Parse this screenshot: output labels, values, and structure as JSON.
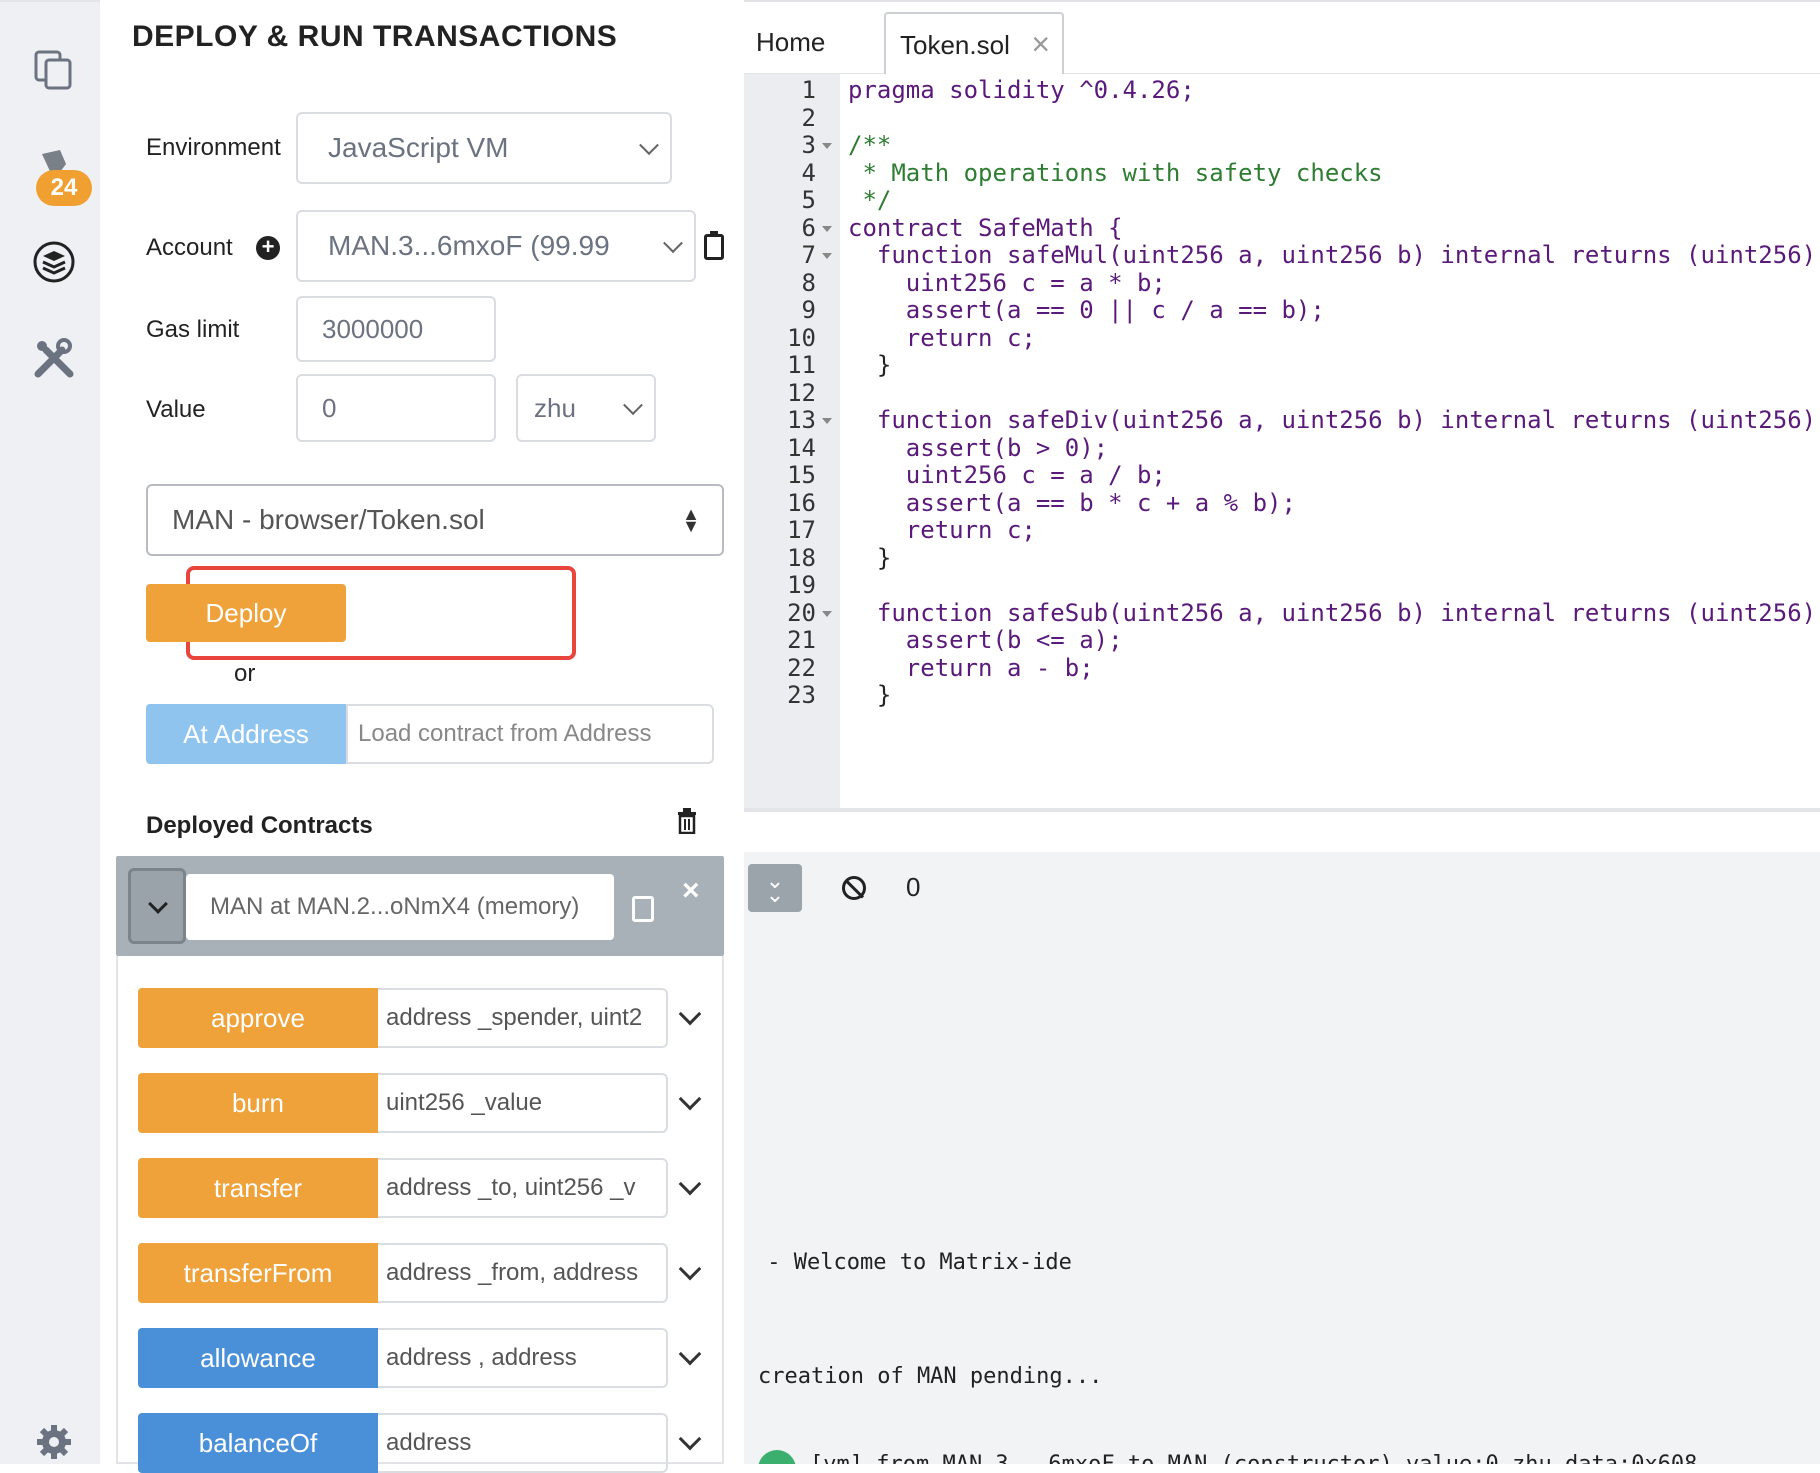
{
  "panel": {
    "title": "DEPLOY & RUN TRANSACTIONS",
    "environment_label": "Environment",
    "environment_value": "JavaScript VM",
    "account_label": "Account",
    "account_value": "MAN.3...6mxoF (99.99",
    "gas_limit_label": "Gas limit",
    "gas_limit_value": "3000000",
    "value_label": "Value",
    "value_value": "0",
    "value_unit": "zhu",
    "contract_select": "MAN - browser/Token.sol",
    "deploy_label": "Deploy",
    "or_label": "or",
    "at_address_label": "At Address",
    "at_address_placeholder": "Load contract from Address",
    "deployed_title": "Deployed Contracts",
    "deployed_instance": "MAN at MAN.2...oNmX4 (memory)",
    "functions": [
      {
        "name": "approve",
        "params": "address _spender, uint2",
        "kind": "transact",
        "color": "#efa13a"
      },
      {
        "name": "burn",
        "params": "uint256 _value",
        "kind": "transact",
        "color": "#efa13a"
      },
      {
        "name": "transfer",
        "params": "address _to, uint256 _v",
        "kind": "transact",
        "color": "#efa13a"
      },
      {
        "name": "transferFrom",
        "params": "address _from, address",
        "kind": "transact",
        "color": "#efa13a"
      },
      {
        "name": "allowance",
        "params": "address , address",
        "kind": "call",
        "color": "#4a90d9"
      },
      {
        "name": "balanceOf",
        "params": "address",
        "kind": "call",
        "color": "#4a90d9"
      }
    ]
  },
  "rail": {
    "icons": [
      "files-icon",
      "compiler-icon",
      "deploy-icon",
      "plugin-manager-icon",
      "settings-icon"
    ],
    "badge": "24"
  },
  "editor": {
    "tabs": [
      "Home",
      "Token.sol"
    ],
    "line_numbers": [
      "1",
      "2",
      "3",
      "4",
      "5",
      "6",
      "7",
      "8",
      "9",
      "10",
      "11",
      "12",
      "13",
      "14",
      "15",
      "16",
      "17",
      "18",
      "19",
      "20",
      "21",
      "22",
      "23"
    ],
    "lines": [
      "pragma solidity ^0.4.26;",
      "",
      "/**",
      " * Math operations with safety checks",
      " */",
      "contract SafeMath {",
      "  function safeMul(uint256 a, uint256 b) internal returns (uint256)",
      "    uint256 c = a * b;",
      "    assert(a == 0 || c / a == b);",
      "    return c;",
      "  }",
      "",
      "  function safeDiv(uint256 a, uint256 b) internal returns (uint256)",
      "    assert(b > 0);",
      "    uint256 c = a / b;",
      "    assert(a == b * c + a % b);",
      "    return c;",
      "  }",
      "",
      "  function safeSub(uint256 a, uint256 b) internal returns (uint256)",
      "    assert(b <= a);",
      "    return a - b;",
      "  }"
    ]
  },
  "terminal": {
    "pending_count": "0",
    "welcome": " - Welcome to Matrix-ide",
    "creation": "creation of MAN pending...",
    "log_partial": "[vm] from MAN.3...6mxoF to MAN.(constructor) value:0 zhu data:0x608"
  }
}
